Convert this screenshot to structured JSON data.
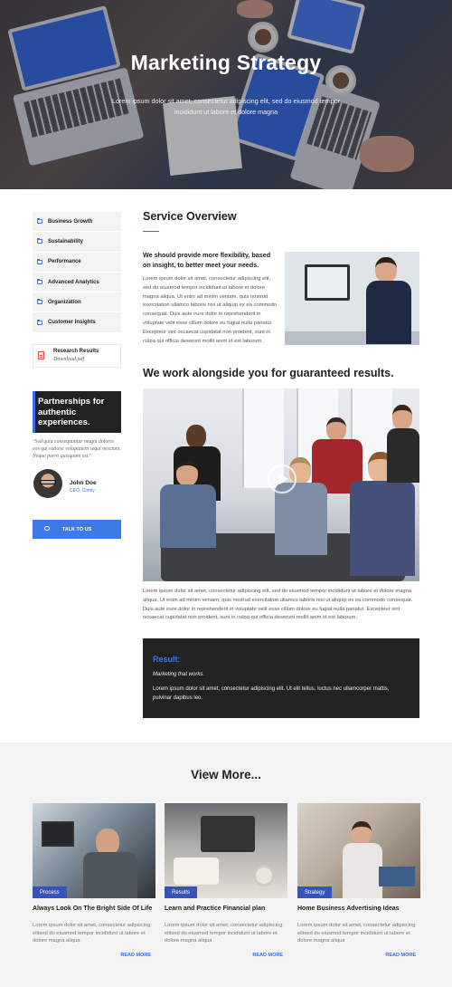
{
  "hero": {
    "title": "Marketing Strategy",
    "subtitle": "Lorem ipsum dolor sit amet, consectetur adipiscing elit, sed do eiusmod tempor incididunt ut labore et dolore magna"
  },
  "sidebar": {
    "items": [
      {
        "label": "Business Growth"
      },
      {
        "label": "Sustainability"
      },
      {
        "label": "Performance"
      },
      {
        "label": "Advanced Analytics"
      },
      {
        "label": "Organization"
      },
      {
        "label": "Customer Insights"
      }
    ],
    "download": {
      "title": "Research Results",
      "file": "Download.pdf"
    },
    "partner_text": "Partnerships for authentic experiences.",
    "quote": "\"Sed quia consequuntur magni dolores eos qui ratione voluptatem sequi nesciunt. Neque porro quisquam est.\"",
    "author": {
      "name": "John Doe",
      "role": "CEO, Comly"
    },
    "cta_label": "TALK TO US"
  },
  "main": {
    "title": "Service Overview",
    "lead": "We should provide more flexibility, based on insight, to better meet your needs.",
    "para1": "Lorem ipsum dolor sit amet, consectetur adipiscing elit, sed do eiusmod tempor incididunt ut labore et dolore magna aliqua. Ut enim ad minim veniam, quis nostrud exercitation ullamco laboris nisi ut aliquip ex ea commodo consequat. Duis aute irure dolor in reprehenderit in voluptate velit esse cillum dolore eu fugiat nulla pariatur. Excepteur sint occaecat cupidatat non proident, sunt in culpa qui officia deserunt mollit anim id est laborum.",
    "heading2": "We work alongside you for guaranteed results.",
    "para2": "Lorem ipsum dolor sit amet, consectetur adipiscing elit, sed do eiusmod tempor incididunt ut labore et dolore magna aliqua. Ut enim ad minim veniam, quis nostrud exercitation ullamco laboris nisi ut aliquip ex ea commodo consequat. Duis aute irure dolor in reprehenderit in voluptate velit esse cillum dolore eu fugiat nulla pariatur. Excepteur sint occaecat cupidatat non proident, sunt in culpa qui officia deserunt mollit anim id est laborum.",
    "result": {
      "title": "Result:",
      "note": "Marketing that works.",
      "text": "Lorem ipsum dolor sit amet, consectetur adipiscing elit. Ut elit tellus, luctus nec ullamcorper mattis, pulvinar dapibus leo."
    }
  },
  "view_more": {
    "title": "View More...",
    "cards": [
      {
        "tag": "Process",
        "title": "Always Look On The Bright Side Of Life",
        "text": "Lorem ipsum dolor sit amet, consectetur adipiscing elitsed do eiusmod tempor incididunt ut labore et dolore magna aliqua",
        "link": "READ MORE"
      },
      {
        "tag": "Results",
        "title": "Learn and Practice Financial plan",
        "text": "Lorem ipsum dolor sit amet, consectetur adipiscing elitsed do eiusmod tempor incididunt ut labore et dolore magna aliqua",
        "link": "READ MORE"
      },
      {
        "tag": "Strategy",
        "title": "Home Business Advertising Ideas",
        "text": "Lorem ipsum dolor sit amet, consectetur adipiscing elitsed do eiusmod tempor incididunt ut labore et dolore magna aliqua",
        "link": "READ MORE"
      }
    ]
  },
  "colors": {
    "accent": "#3a6ee8",
    "dark": "#222222",
    "tag": "#3553b8",
    "section_bg": "#f3f3f3"
  },
  "icons": [
    "folder-icon",
    "pdf-icon",
    "chat-icon",
    "play-icon"
  ]
}
